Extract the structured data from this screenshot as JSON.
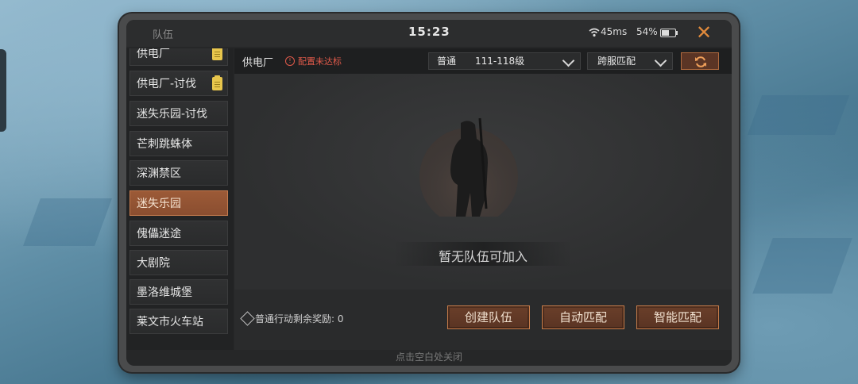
{
  "statusbar": {
    "title": "队伍",
    "time": "15:23",
    "ping": "45ms",
    "battery": "54%",
    "battery_level": 0.54,
    "close_icon": "close-x"
  },
  "sidebar": {
    "items": [
      {
        "label": "供电厂",
        "badge": true,
        "active": false
      },
      {
        "label": "供电厂-讨伐",
        "badge": true,
        "active": false
      },
      {
        "label": "迷失乐园-讨伐",
        "badge": false,
        "active": false
      },
      {
        "label": "芒刺跳蛛体",
        "badge": false,
        "active": false
      },
      {
        "label": "深渊禁区",
        "badge": false,
        "active": false
      },
      {
        "label": "迷失乐园",
        "badge": false,
        "active": true
      },
      {
        "label": "傀儡迷途",
        "badge": false,
        "active": false
      },
      {
        "label": "大剧院",
        "badge": false,
        "active": false
      },
      {
        "label": "墨洛维城堡",
        "badge": false,
        "active": false
      },
      {
        "label": "莱文市火车站",
        "badge": false,
        "active": false
      }
    ]
  },
  "topbar": {
    "map_name": "供电厂",
    "warning": "配置未达标",
    "mode": "普通",
    "level_range": "111-118级",
    "server": "跨服匹配",
    "refresh_icon": "refresh-icon"
  },
  "content": {
    "empty_message": "暂无队伍可加入"
  },
  "bottombar": {
    "reward_text": "普通行动剩余奖励: 0",
    "create_team": "创建队伍",
    "auto_match": "自动匹配",
    "smart_match": "智能匹配"
  },
  "hint": "点击空白处关闭",
  "colors": {
    "accent": "#c67c4a",
    "active_item": "#9c5a37",
    "warning": "#e05a4a",
    "badge": "#e8c64c"
  }
}
